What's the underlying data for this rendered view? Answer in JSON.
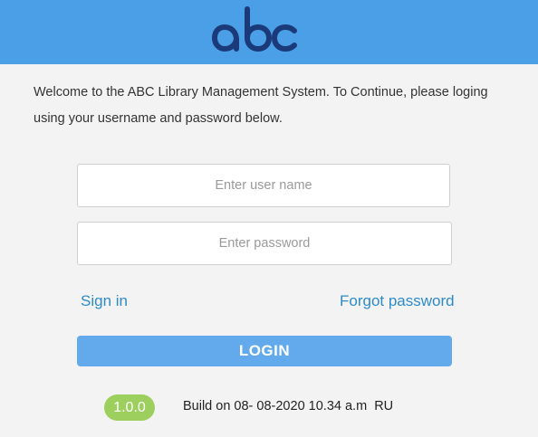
{
  "app": {
    "logo_text": "abc",
    "brand_color": "#4a9fe6",
    "logo_color": "#1a3a7a"
  },
  "welcome": {
    "line1": "Welcome to the ABC Library Management System. To Continue, please loging",
    "line2": "using your username and password below."
  },
  "form": {
    "username_placeholder": "Enter user name",
    "username_value": "",
    "password_placeholder": "Enter password",
    "password_value": "",
    "sign_in_label": "Sign in",
    "forgot_password_label": "Forgot password",
    "login_button_label": "LOGIN",
    "login_button_color": "#62aaeb",
    "link_color": "#2e8bc7"
  },
  "footer": {
    "version": "1.0.0",
    "version_badge_color": "#9ccf5e",
    "build_text": "Build on 08- 08-2020 10.34 a.m  RU"
  }
}
